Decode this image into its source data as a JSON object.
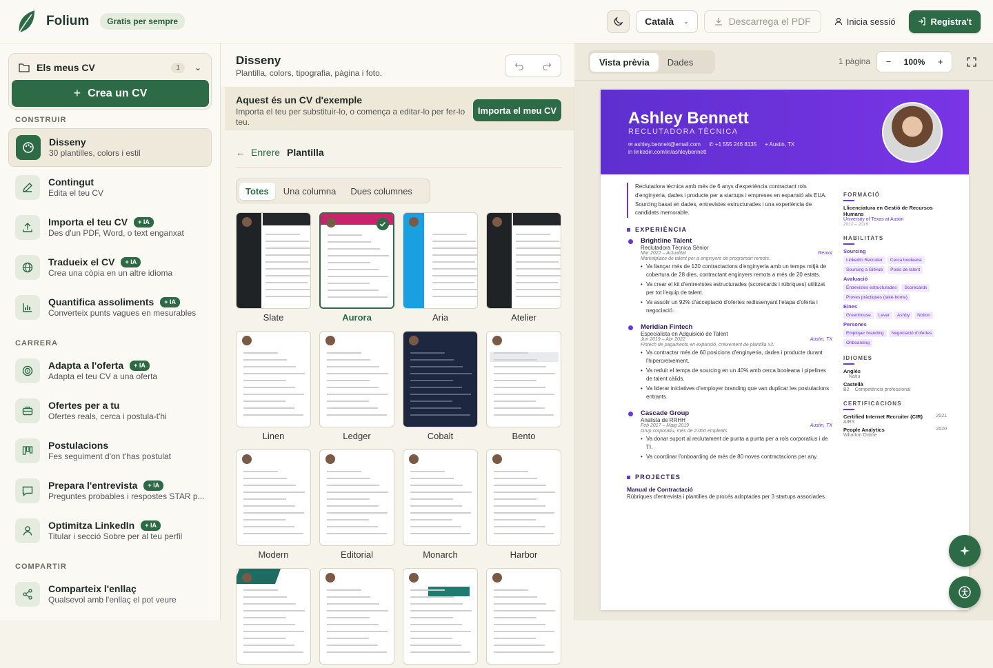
{
  "header": {
    "brand": "Folium",
    "badge": "Gratis per sempre",
    "language": "Català",
    "download_pdf": "Descarrega el PDF",
    "login": "Inicia sessió",
    "register": "Registra't"
  },
  "sidebar": {
    "mycv": {
      "title": "Els meus CV",
      "count": "1",
      "create": "Crea un CV"
    },
    "sections": {
      "build": "CONSTRUIR",
      "career": "CARRERA",
      "share": "COMPARTIR"
    },
    "ia_badge": "+ IA",
    "items": [
      {
        "title": "Disseny",
        "sub": "30 plantilles, colors i estil",
        "icon": "palette-icon"
      },
      {
        "title": "Contingut",
        "sub": "Edita el teu CV",
        "icon": "pencil-icon"
      },
      {
        "title": "Importa el teu CV",
        "sub": "Des d'un PDF, Word, o text enganxat",
        "icon": "upload-icon"
      },
      {
        "title": "Tradueix el CV",
        "sub": "Crea una còpia en un altre idioma",
        "icon": "globe-icon"
      },
      {
        "title": "Quantifica assoliments",
        "sub": "Converteix punts vagues en mesurables",
        "icon": "bar-chart-icon"
      },
      {
        "title": "Adapta a l'oferta",
        "sub": "Adapta el teu CV a una oferta",
        "icon": "target-icon"
      },
      {
        "title": "Ofertes per a tu",
        "sub": "Ofertes reals, cerca i postula-t'hi",
        "icon": "briefcase-icon"
      },
      {
        "title": "Postulacions",
        "sub": "Fes seguiment d'on t'has postulat",
        "icon": "kanban-icon"
      },
      {
        "title": "Prepara l'entrevista",
        "sub": "Preguntes probables i respostes STAR p...",
        "icon": "chat-icon"
      },
      {
        "title": "Optimitza LinkedIn",
        "sub": "Titular i secció Sobre per al teu perfil",
        "icon": "user-icon"
      },
      {
        "title": "Comparteix l'enllaç",
        "sub": "Qualsevol amb l'enllaç el pot veure",
        "icon": "share-icon"
      }
    ]
  },
  "design": {
    "title": "Disseny",
    "subtitle": "Plantilla, colors, tipografia, pàgina i foto.",
    "sample_title": "Aquest és un CV d'exemple",
    "sample_sub": "Importa el teu per substituir-lo, o comença a editar-lo per fer-lo teu.",
    "import_button": "Importa el meu CV",
    "back": "Enrere",
    "crumb": "Plantilla",
    "filters": [
      "Totes",
      "Una columna",
      "Dues columnes"
    ],
    "templates": [
      "Slate",
      "Aurora",
      "Aria",
      "Atelier",
      "Linen",
      "Ledger",
      "Cobalt",
      "Bento",
      "Modern",
      "Editorial",
      "Monarch",
      "Harbor",
      "",
      "",
      "",
      ""
    ],
    "selected_template": "Aurora"
  },
  "preview": {
    "tabs": [
      "Vista prèvia",
      "Dades"
    ],
    "pages": "1 pàgina",
    "zoom": "100%",
    "minus": "−",
    "plus": "+",
    "accent": "#6b35dd"
  },
  "cv": {
    "name": "Ashley Bennett",
    "role": "RECLUTADORA TÈCNICA",
    "email": "ashley.bennett@email.com",
    "phone": "+1 555 246 8135",
    "location": "Austin, TX",
    "linkedin": "linkedin.com/in/ashleybennett",
    "summary": "Reclutadora tècnica amb més de 6 anys d'experiència contractant rols d'enginyeria, dades i producte per a startups i empreses en expansió als EUA. Sourcing basat en dades, entrevistes estructurades i una experiència de candidats memorable.",
    "experience_title": "EXPERIÈNCIA",
    "jobs": [
      {
        "company": "Brightline Talent",
        "role": "Reclutadora Tècnica Sènior",
        "dates": "Mar 2022 – Actualitat",
        "place": "Remot",
        "desc": "Marketplace de talent per a enginyers de programari remots.",
        "bullets": [
          "Va llançar més de 120 contractacions d'enginyeria amb un temps mitjà de cobertura de 28 dies, contractant enginyers remots a més de 20 estats.",
          "Va crear el kit d'entrevistes estructurades (scorecards i rúbriques) utilitzat per tot l'equip de talent.",
          "Va assolir un 92% d'acceptació d'ofertes redissenyant l'etapa d'oferta i negociació."
        ]
      },
      {
        "company": "Meridian Fintech",
        "role": "Especialista en Adquisició de Talent",
        "dates": "Jun 2019 – Abr 2022",
        "place": "Austin, TX",
        "desc": "Fintech de pagaments en expansió, creixement de plantilla x3.",
        "bullets": [
          "Va contractar més de 60 posicions d'enginyeria, dades i producte durant l'hipercreixement.",
          "Va reduir el temps de sourcing en un 40% amb cerca booleana i pipelines de talent càlids.",
          "Va liderar iniciatives d'employer branding que van duplicar les postulacions entrants."
        ]
      },
      {
        "company": "Cascade Group",
        "role": "Analista de RRHH",
        "dates": "Feb 2017 – Maig 2019",
        "place": "Austin, TX",
        "desc": "Grup corporatiu, més de 2.000 empleats.",
        "bullets": [
          "Va donar suport al reclutament de punta a punta per a rols corporatius i de TI.",
          "Va coordinar l'onboarding de més de 80 noves contractacions per any."
        ]
      }
    ],
    "projects_title": "PROJECTES",
    "project_name": "Manual de Contractació",
    "project_desc": "Rúbriques d'entrevista i plantilles de procés adoptades per 3 startups associades.",
    "education_title": "FORMACIÓ",
    "degree": "Llicenciatura en Gestió de Recursos Humans",
    "school": "University of Texas at Austin",
    "edu_dates": "2012 – 2016",
    "skills_title": "HABILITATS",
    "skill_groups": [
      {
        "name": "Sourcing",
        "chips": [
          "LinkedIn Recruiter",
          "Cerca booleana",
          "Sourcing a GitHub",
          "Pools de talent"
        ]
      },
      {
        "name": "Avaluació",
        "chips": [
          "Entrevistes estructurades",
          "Scorecards",
          "Proves pràctiques (take-home)"
        ]
      },
      {
        "name": "Eines",
        "chips": [
          "Greenhouse",
          "Lever",
          "Ashby",
          "Notion"
        ]
      },
      {
        "name": "Persones",
        "chips": [
          "Employer branding",
          "Negociació d'ofertes",
          "Onboarding"
        ]
      }
    ],
    "languages_title": "IDIOMES",
    "languages": [
      {
        "name": "Anglès",
        "level": "Natiu",
        "code": ""
      },
      {
        "name": "Castellà",
        "level": "Competència professional",
        "code": "B2"
      }
    ],
    "certs_title": "CERTIFICACIONS",
    "certs": [
      {
        "name": "Certified Internet Recruiter (CIR)",
        "org": "AIRS",
        "year": "2021"
      },
      {
        "name": "People Analytics",
        "org": "Wharton Online",
        "year": "2020"
      }
    ]
  }
}
